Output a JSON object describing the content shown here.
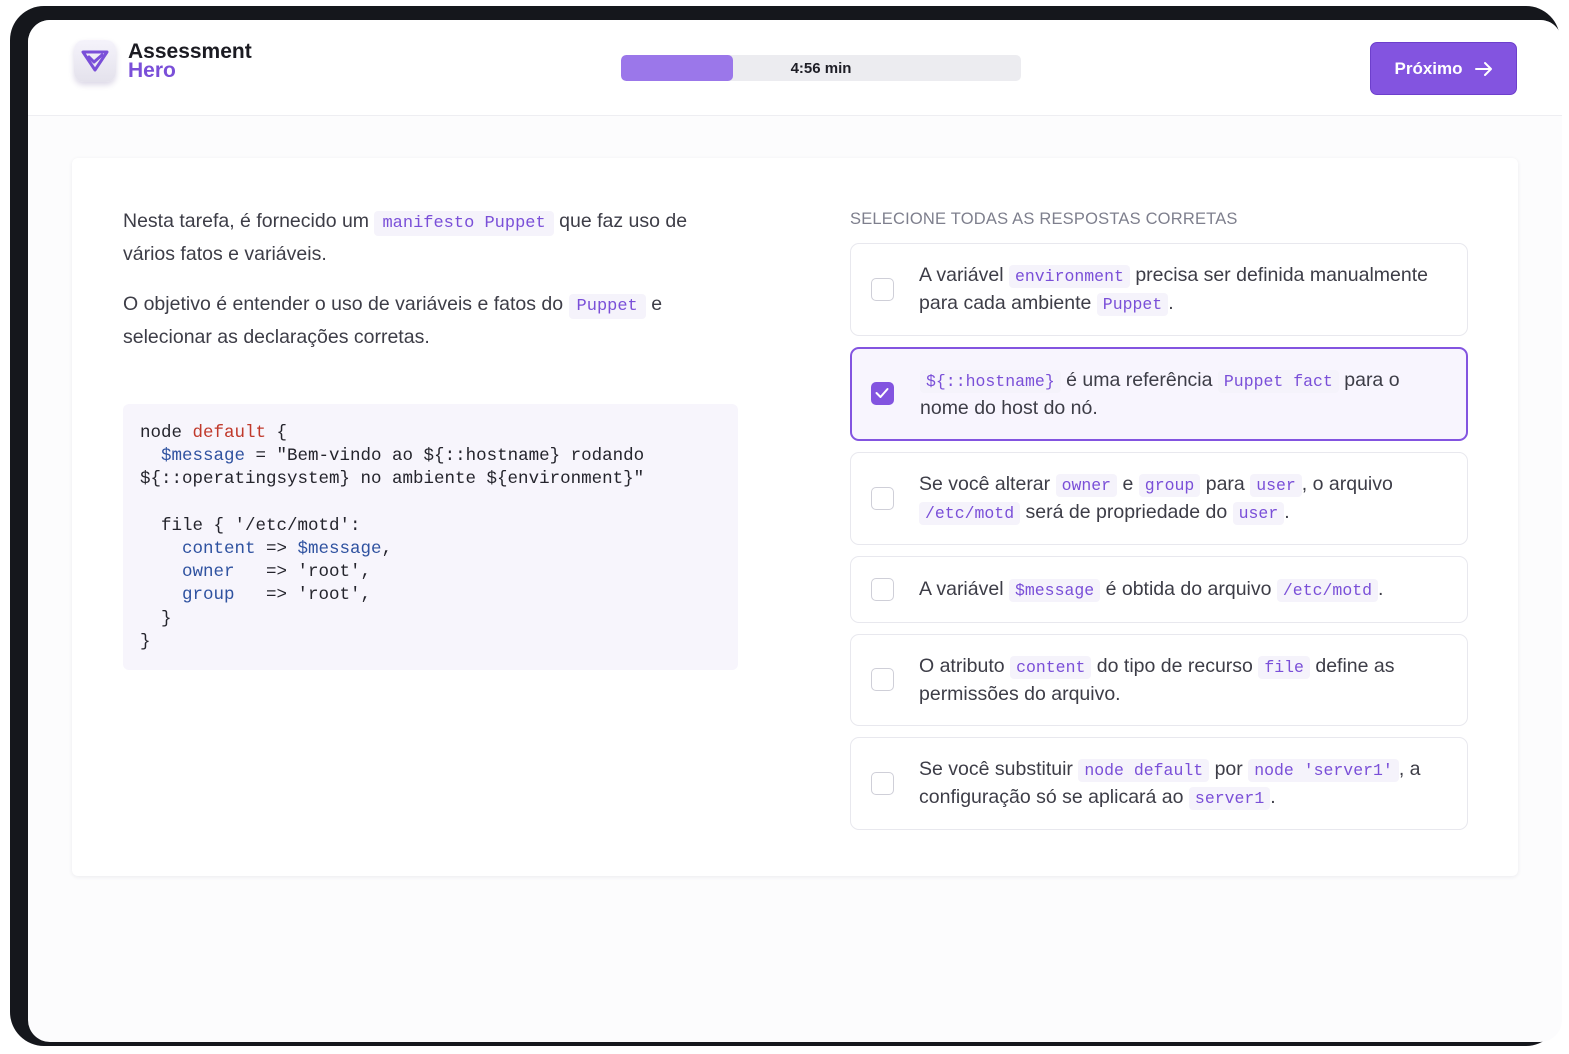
{
  "app": {
    "logo_line1": "Assessment",
    "logo_line2": "Hero"
  },
  "timer": {
    "label": "4:56 min",
    "progress": 0.28
  },
  "next_button": {
    "label": "Próximo"
  },
  "task": {
    "p1_a": "Nesta tarefa, é fornecido um",
    "p1_code": "manifesto Puppet",
    "p1_b": "que faz uso de vários fatos e variáveis.",
    "p2_a": "O objetivo é entender o uso de variáveis e fatos do",
    "p2_code": "Puppet",
    "p2_b": "e selecionar as declarações corretas."
  },
  "code": {
    "l1_a": "node ",
    "l1_kw": "default",
    "l1_b": " {",
    "l2_indent": "  ",
    "l2_var": "$message",
    "l2_b": " = \"Bem-vindo ao ${::hostname} rodando",
    "l3": "${::operatingsystem} no ambiente ${environment}\"",
    "l5": "  file { '/etc/motd':",
    "l6_indent": "    ",
    "l6_key": "content",
    "l6_op": " => ",
    "l6_val": "$message",
    "l6_end": ",",
    "l7_indent": "    ",
    "l7_key": "owner",
    "l7_rest": "   => 'root',",
    "l8_indent": "    ",
    "l8_key": "group",
    "l8_rest": "   => 'root',",
    "l9": "  }",
    "l10": "}"
  },
  "question": {
    "instruction": "SELECIONE TODAS AS RESPOSTAS CORRETAS",
    "options": [
      {
        "selected": false,
        "t1": "A variável",
        "c1": "environment",
        "t2": "precisa ser definida manualmente para cada ambiente",
        "c2": "Puppet",
        "t3": "."
      },
      {
        "selected": true,
        "c1": "${::hostname}",
        "t1": "é uma referência",
        "c2": "Puppet fact",
        "t2": "para o nome do host do nó."
      },
      {
        "selected": false,
        "t1": "Se você alterar",
        "c1": "owner",
        "t2": "e",
        "c2": "group",
        "t3": "para",
        "c3": "user",
        "t4": ", o arquivo",
        "c4": "/etc/motd",
        "t5": "será de propriedade do",
        "c5": "user",
        "t6": "."
      },
      {
        "selected": false,
        "t1": "A variável",
        "c1": "$message",
        "t2": "é obtida do arquivo",
        "c2": "/etc/motd",
        "t3": "."
      },
      {
        "selected": false,
        "t1": "O atributo",
        "c1": "content",
        "t2": "do tipo de recurso",
        "c2": "file",
        "t3": "define as permissões do arquivo."
      },
      {
        "selected": false,
        "t1": "Se você substituir",
        "c1": "node default",
        "t2": "por",
        "c2": "node 'server1'",
        "t3": ", a configuração só se aplicará ao",
        "c3": "server1",
        "t4": "."
      }
    ]
  },
  "icons": {
    "logo": "shield-check-icon",
    "next": "arrow-right-icon",
    "checked": "checkmark-icon"
  },
  "colors": {
    "accent": "#8354e0",
    "progress_fill": "#9b77ea",
    "inline_code": "#7a4fd8"
  }
}
